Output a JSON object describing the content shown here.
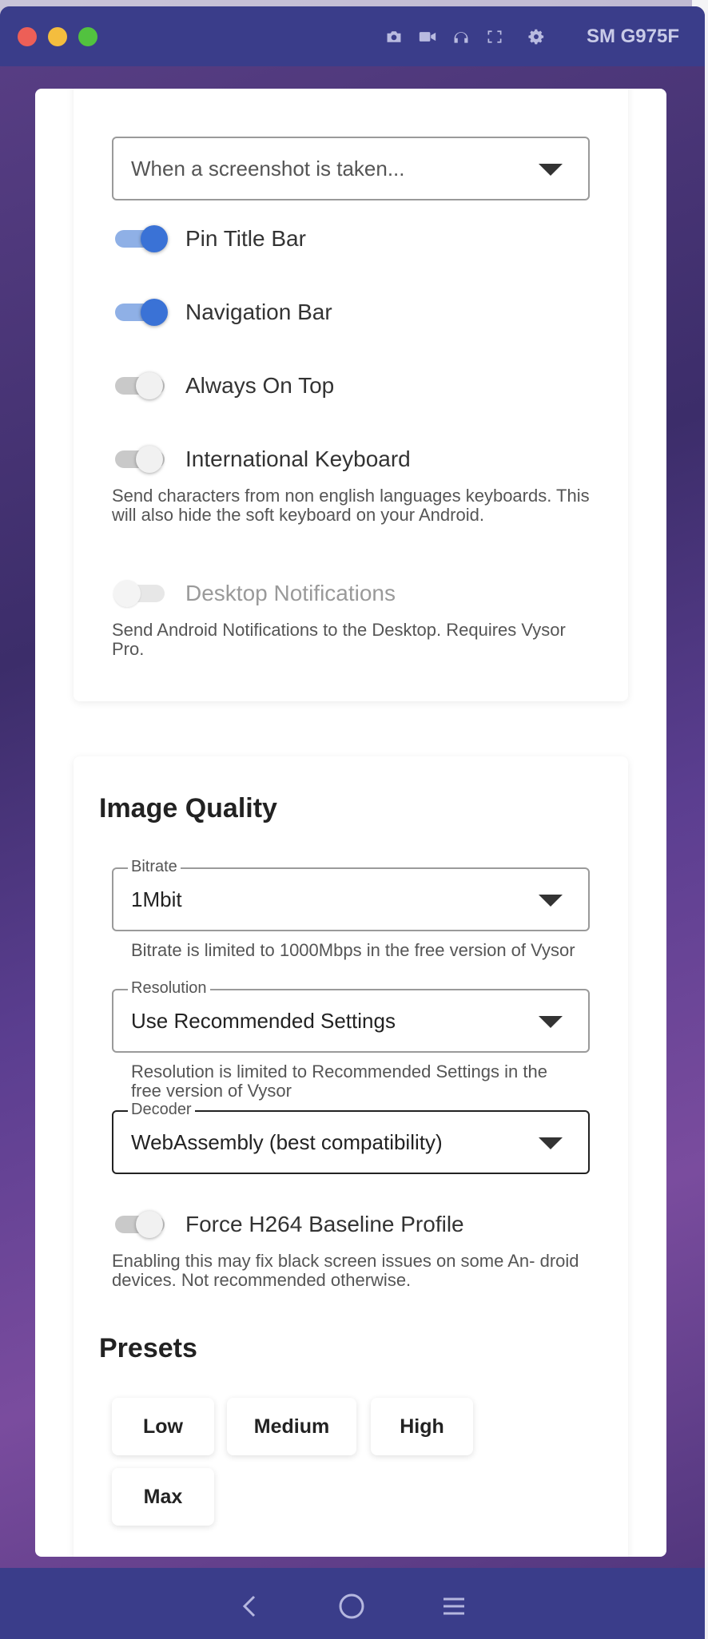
{
  "titlebar": {
    "device_name": "SM G975F",
    "icons": [
      "camera-icon",
      "video-icon",
      "headphones-icon",
      "fullscreen-icon",
      "gear-icon"
    ]
  },
  "settings": {
    "screenshot_select": {
      "placeholder": "When a screenshot is taken..."
    },
    "toggles": [
      {
        "label": "Pin Title Bar",
        "state": "on"
      },
      {
        "label": "Navigation Bar",
        "state": "on"
      },
      {
        "label": "Always On Top",
        "state": "off"
      },
      {
        "label": "International Keyboard",
        "state": "off"
      },
      {
        "label": "Desktop Notifications",
        "state": "disabled"
      }
    ],
    "intl_keyboard_help": "Send characters from non english languages keyboards. This will also hide the soft keyboard on your Android.",
    "notifications_help": "Send Android Notifications to the Desktop. Requires Vysor Pro."
  },
  "image_quality": {
    "title": "Image Quality",
    "bitrate": {
      "legend": "Bitrate",
      "value": "1Mbit",
      "help": "Bitrate is limited to 1000Mbps in the free version of Vysor"
    },
    "resolution": {
      "legend": "Resolution",
      "value": "Use Recommended Settings",
      "help": "Resolution is limited to Recommended Settings in the free version of Vysor"
    },
    "decoder": {
      "legend": "Decoder",
      "value": "WebAssembly (best compatibility)"
    },
    "h264_toggle": {
      "label": "Force H264 Baseline Profile",
      "state": "off"
    },
    "h264_help": "Enabling this may fix black screen issues on some An- droid devices. Not recommended otherwise."
  },
  "presets": {
    "title": "Presets",
    "buttons": [
      "Low",
      "Medium",
      "High",
      "Max"
    ]
  },
  "navbar": {
    "icons": [
      "back-icon",
      "home-icon",
      "recents-icon"
    ]
  },
  "colors": {
    "titlebar": "#3a3d8a",
    "toggle_on": "#3a72d6",
    "toggle_track_on": "#8fb0e6"
  }
}
